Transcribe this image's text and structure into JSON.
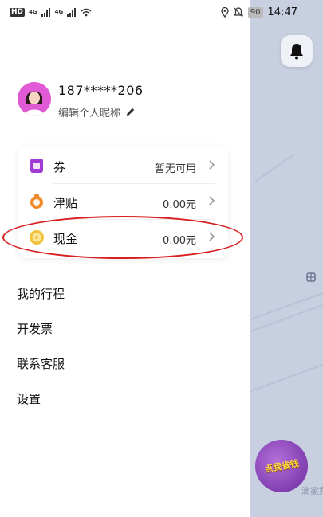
{
  "status_bar": {
    "hd_badge": "HD",
    "network_1": "4G",
    "network_2": "4G",
    "battery": "90",
    "time": "14:47"
  },
  "drawer": {
    "user": {
      "phone": "187*****206",
      "edit_nickname": "编辑个人昵称"
    },
    "wallet": [
      {
        "label": "券",
        "value": "暂无可用",
        "icon": "coupon-icon",
        "color": "#a23bd3"
      },
      {
        "label": "津贴",
        "value": "0.00元",
        "icon": "allowance-icon",
        "color": "#f08a2a"
      },
      {
        "label": "现金",
        "value": "0.00元",
        "icon": "cash-icon",
        "color": "#f2c23a"
      }
    ],
    "menu": [
      {
        "label": "我的行程"
      },
      {
        "label": "开发票"
      },
      {
        "label": "联系客服"
      },
      {
        "label": "设置"
      }
    ]
  },
  "map": {
    "promo_text": "点我省钱",
    "promo_caption": "滴家乘"
  },
  "colors": {
    "highlight": "#d81e1e",
    "map_bg": "#c7cfe0"
  }
}
